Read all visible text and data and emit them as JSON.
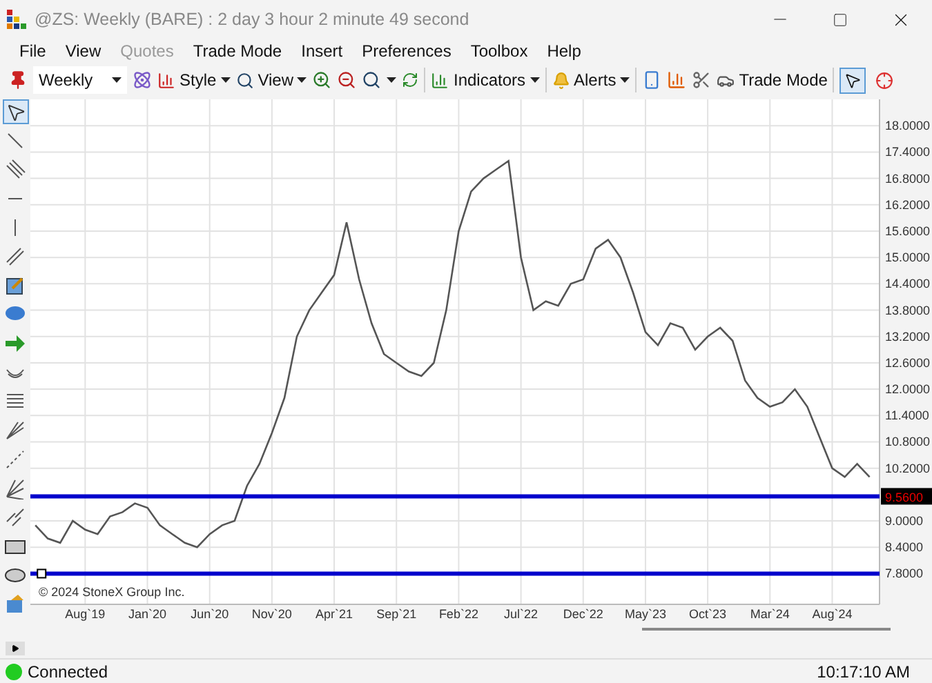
{
  "window": {
    "title": "@ZS: Weekly (BARE) : 2 day 3 hour 2 minute 49 second"
  },
  "menu": [
    {
      "label": "File",
      "disabled": false
    },
    {
      "label": "View",
      "disabled": false
    },
    {
      "label": "Quotes",
      "disabled": true
    },
    {
      "label": "Trade Mode",
      "disabled": false
    },
    {
      "label": "Insert",
      "disabled": false
    },
    {
      "label": "Preferences",
      "disabled": false
    },
    {
      "label": "Toolbox",
      "disabled": false
    },
    {
      "label": "Help",
      "disabled": false
    }
  ],
  "toolbar": {
    "period": "Weekly",
    "style": "Style",
    "view": "View",
    "indicators": "Indicators",
    "alerts": "Alerts",
    "trade_mode": "Trade Mode",
    "tools": [
      {
        "selected": true
      },
      {
        "selected": false
      }
    ]
  },
  "left_tools": [
    {
      "selected": true
    },
    {
      "selected": false
    },
    {
      "selected": false
    },
    {
      "selected": false
    },
    {
      "selected": false
    },
    {
      "selected": false
    },
    {
      "selected": false
    },
    {
      "selected": false
    },
    {
      "selected": false
    },
    {
      "selected": false
    },
    {
      "selected": false
    },
    {
      "selected": false
    },
    {
      "selected": false
    },
    {
      "selected": false
    },
    {
      "selected": false
    },
    {
      "selected": false
    },
    {
      "selected": false
    },
    {
      "selected": false
    }
  ],
  "chart": {
    "copyright": "© 2024 StoneX Group Inc.",
    "chart_data": {
      "type": "line",
      "categories": [
        null,
        null,
        null,
        null,
        "Aug`19",
        null,
        null,
        null,
        null,
        "Jan`20",
        null,
        null,
        null,
        null,
        "Jun`20",
        null,
        null,
        null,
        null,
        "Nov`20",
        null,
        null,
        null,
        null,
        "Apr`21",
        null,
        null,
        null,
        null,
        "Sep`21",
        null,
        null,
        null,
        null,
        "Feb`22",
        null,
        null,
        null,
        null,
        "Jul`22",
        null,
        null,
        null,
        null,
        "Dec`22",
        null,
        null,
        null,
        null,
        "May`23",
        null,
        null,
        null,
        null,
        "Oct`23",
        null,
        null,
        null,
        null,
        "Mar`24",
        null,
        null,
        null,
        null,
        "Aug`24",
        null,
        null,
        null
      ],
      "series": [
        {
          "color": "#555555",
          "values": [
            8.9,
            8.6,
            8.5,
            9.0,
            8.8,
            8.7,
            9.1,
            9.2,
            9.4,
            9.3,
            8.9,
            8.7,
            8.5,
            8.4,
            8.7,
            8.9,
            9.0,
            9.8,
            10.3,
            11.0,
            11.8,
            13.2,
            13.8,
            14.2,
            14.6,
            15.8,
            14.5,
            13.5,
            12.8,
            12.6,
            12.4,
            12.3,
            12.6,
            13.8,
            15.6,
            16.5,
            16.8,
            17.0,
            17.2,
            15.0,
            13.8,
            14.0,
            13.9,
            14.4,
            14.5,
            15.2,
            15.4,
            15.0,
            14.2,
            13.3,
            13.0,
            13.5,
            13.4,
            12.9,
            13.2,
            13.4,
            13.1,
            12.2,
            11.8,
            11.6,
            11.7,
            12.0,
            11.6,
            10.9,
            10.2,
            10.0,
            10.3,
            10.0
          ]
        }
      ],
      "ylim": [
        7.1,
        18.6
      ],
      "yticks": [
        {
          "value": 7.8,
          "label": "7.8000"
        },
        {
          "value": 8.4,
          "label": "8.4000"
        },
        {
          "value": 9.0,
          "label": "9.0000"
        },
        {
          "value": 10.2,
          "label": "10.2000"
        },
        {
          "value": 10.8,
          "label": "10.8000"
        },
        {
          "value": 11.4,
          "label": "11.4000"
        },
        {
          "value": 12.0,
          "label": "12.0000"
        },
        {
          "value": 12.6,
          "label": "12.6000"
        },
        {
          "value": 13.2,
          "label": "13.2000"
        },
        {
          "value": 13.8,
          "label": "13.8000"
        },
        {
          "value": 14.4,
          "label": "14.4000"
        },
        {
          "value": 15.0,
          "label": "15.0000"
        },
        {
          "value": 15.6,
          "label": "15.6000"
        },
        {
          "value": 16.2,
          "label": "16.2000"
        },
        {
          "value": 16.8,
          "label": "16.8000"
        },
        {
          "value": 17.4,
          "label": "17.4000"
        },
        {
          "value": 18.0,
          "label": "18.0000"
        }
      ],
      "grid": true,
      "ref_lines": [
        {
          "axis": "y",
          "value": 9.56,
          "label": "9.5600",
          "color": "#0000cc"
        },
        {
          "axis": "y",
          "value": 7.8,
          "color": "#0000cc"
        }
      ]
    }
  },
  "status": {
    "connected": true,
    "label": "Connected",
    "time": "10:17:10 AM"
  }
}
